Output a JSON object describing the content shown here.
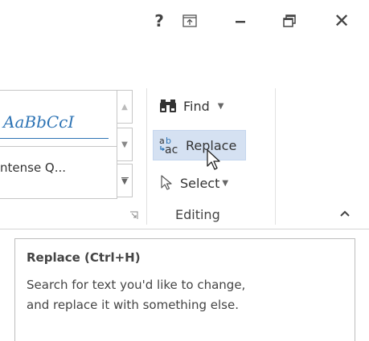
{
  "title_bar": {
    "help_glyph": "?",
    "close_glyph": "✕"
  },
  "ribbon": {
    "styles": {
      "sample_text": "AaBbCcI",
      "style_name": "ntense Q..."
    },
    "editing": {
      "find_label": "Find",
      "replace_label": "Replace",
      "select_label": "Select",
      "group_label": "Editing"
    }
  },
  "tooltip": {
    "title": "Replace (Ctrl+H)",
    "description_line1": "Search for text you'd like to change,",
    "description_line2": "and replace it with something else."
  },
  "colors": {
    "accent_blue": "#2e74b5",
    "hover_highlight": "#d5e1f2",
    "text": "#444444"
  }
}
